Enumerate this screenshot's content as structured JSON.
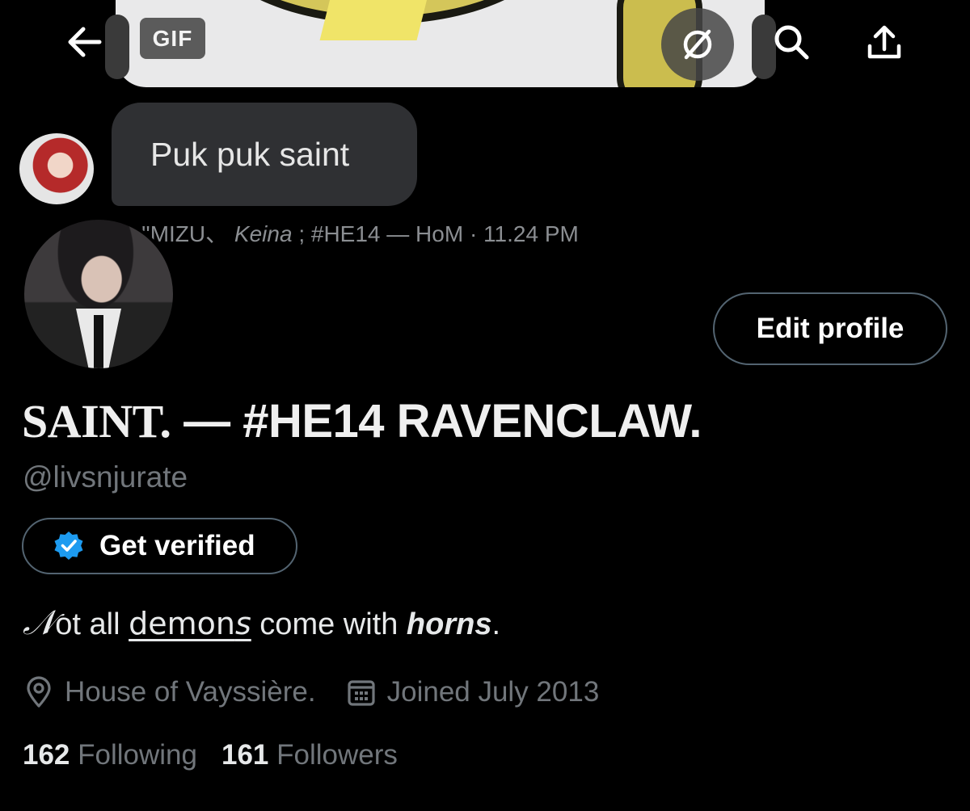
{
  "media": {
    "gif_badge": "GIF"
  },
  "reply": {
    "text": "Puk puk saint",
    "author_prefix": "''MIZU、",
    "author_italic": "Keina",
    "author_suffix": "; #HE14 — HoM",
    "timestamp": "· 11.24 PM"
  },
  "profile": {
    "edit_button": "Edit profile",
    "display_name_serif": "SAINT.",
    "display_name_rest": " — #HE14 RAVENCLAW.",
    "handle": "@livsnjurate",
    "verify_button": "Get verified",
    "bio": {
      "script_letter": "𝒩",
      "part1": "ot all ",
      "demons_plain": "demon",
      "demons_italic": "s",
      "part2": " come with ",
      "horns": "horns",
      "end": "."
    },
    "location": "House of Vayssière.",
    "joined": "Joined July 2013",
    "following_count": "162",
    "following_label": "Following",
    "followers_count": "161",
    "followers_label": "Followers"
  },
  "icons": {
    "back": "arrow-left-icon",
    "no_gif": "no-symbol-icon",
    "search": "search-icon",
    "share": "share-icon",
    "verified": "verified-badge-icon",
    "location": "location-pin-icon",
    "calendar": "calendar-icon"
  },
  "colors": {
    "background": "#000000",
    "verified_blue": "#1d9bf0",
    "muted_text": "#71767b",
    "bubble": "#2f3033"
  }
}
